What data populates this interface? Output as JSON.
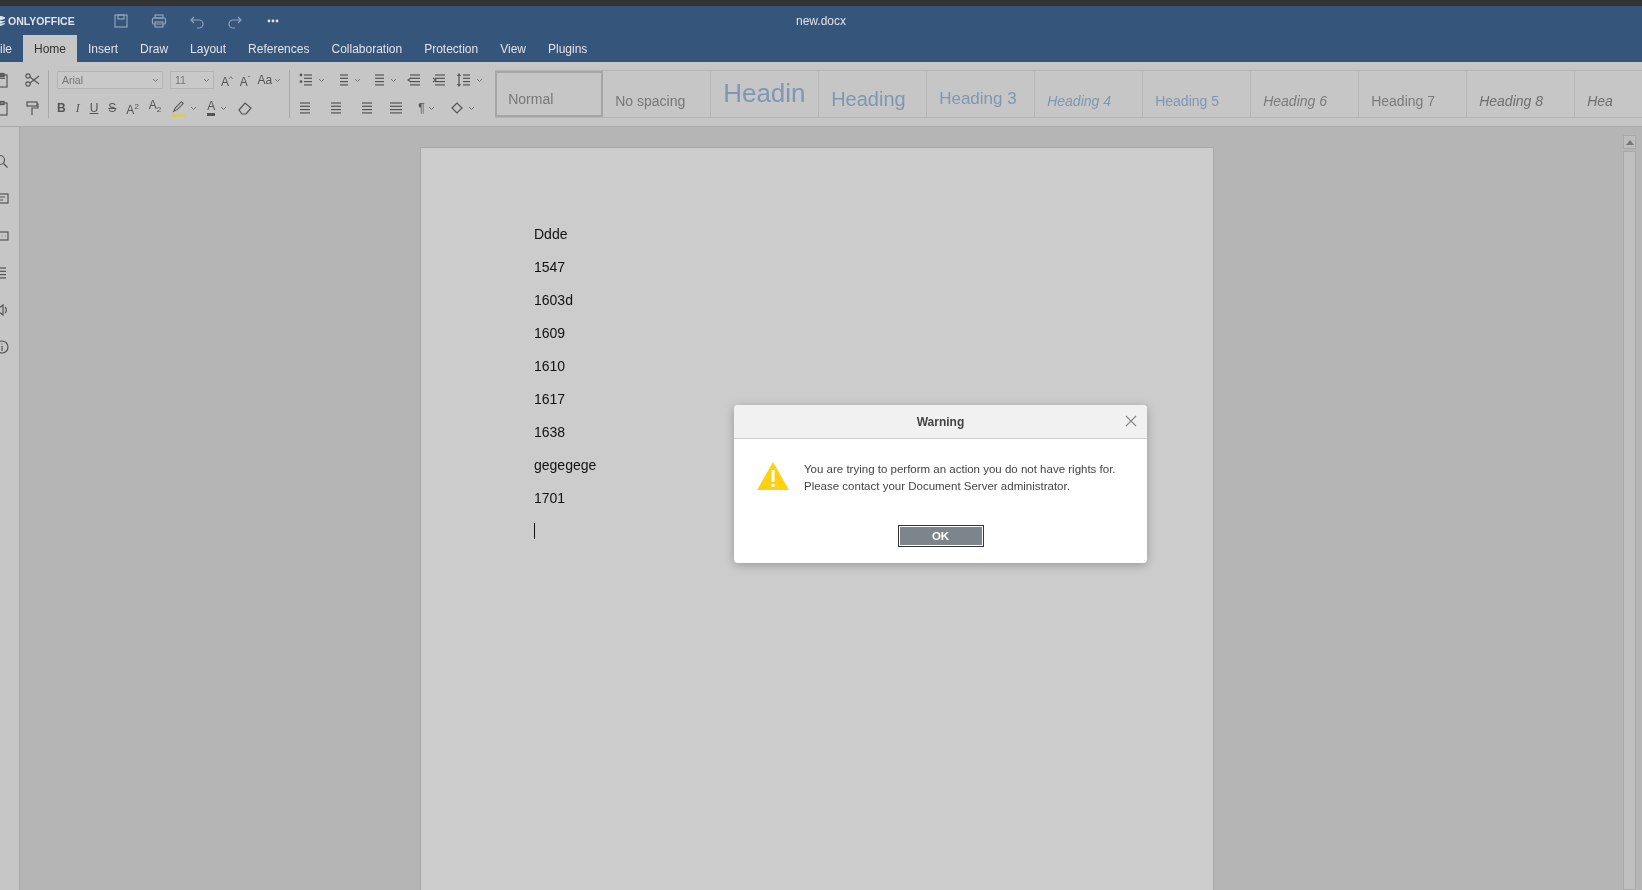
{
  "app": {
    "logo": "ONLYOFFICE",
    "document_title": "new.docx"
  },
  "tabs": [
    {
      "label": "ile",
      "selected": false
    },
    {
      "label": "Home",
      "selected": true
    },
    {
      "label": "Insert",
      "selected": false
    },
    {
      "label": "Draw",
      "selected": false
    },
    {
      "label": "Layout",
      "selected": false
    },
    {
      "label": "References",
      "selected": false
    },
    {
      "label": "Collaboration",
      "selected": false
    },
    {
      "label": "Protection",
      "selected": false
    },
    {
      "label": "View",
      "selected": false
    },
    {
      "label": "Plugins",
      "selected": false
    }
  ],
  "toolbar": {
    "font_name": {
      "placeholder": "Arial"
    },
    "font_size": {
      "placeholder": "11"
    },
    "case_button": "Aa",
    "grow_button": "A$^{^}$",
    "shrink_button": "A$^{ˇ}$",
    "format_buttons": [
      {
        "glyph": "B",
        "kind": "bold"
      },
      {
        "glyph": "I",
        "kind": "italic"
      },
      {
        "glyph": "U",
        "kind": "underline"
      },
      {
        "glyph": "S",
        "kind": "strike"
      },
      {
        "glyph": "A$^{2}$",
        "kind": "superscript"
      },
      {
        "glyph": "A$_{2}$",
        "kind": "subscript"
      }
    ],
    "font_color_button": "A",
    "pilcrow_button": "¶"
  },
  "styles": [
    {
      "label": "Normal",
      "kind": "normal",
      "selected": true
    },
    {
      "label": "No spacing",
      "kind": "normal",
      "selected": false
    },
    {
      "label": "Headin",
      "kind": "h1",
      "selected": false
    },
    {
      "label": "Heading",
      "kind": "h2",
      "selected": false
    },
    {
      "label": "Heading 3",
      "kind": "h3",
      "selected": false
    },
    {
      "label": "Heading 4",
      "kind": "h4",
      "selected": false
    },
    {
      "label": "Heading 5",
      "kind": "h5",
      "selected": false
    },
    {
      "label": "Heading 6",
      "kind": "h6",
      "selected": false
    },
    {
      "label": "Heading 7",
      "kind": "h7",
      "selected": false
    },
    {
      "label": "Heading 8",
      "kind": "h8",
      "selected": false
    },
    {
      "label": "Hea",
      "kind": "h8",
      "selected": false
    }
  ],
  "document": {
    "paragraphs": [
      "Ddde",
      "1547",
      "1603d",
      "1609",
      "1610",
      "1617",
      "1638",
      "gegegege",
      "1701"
    ]
  },
  "dialog": {
    "title": "Warning",
    "message": "You are trying to perform an action you do not have rights for.\nPlease contact your Document Server administrator.",
    "button": "OK"
  }
}
